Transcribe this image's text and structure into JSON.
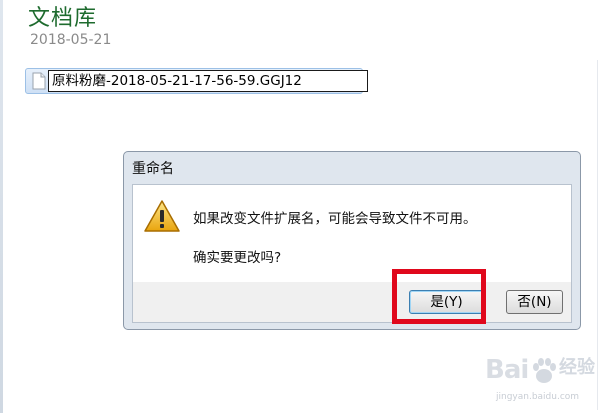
{
  "page": {
    "title": "文档库",
    "date": "2018-05-21"
  },
  "file": {
    "name_value": "原料粉磨-2018-05-21-17-56-59.GGJ12"
  },
  "dialog": {
    "title": "重命名",
    "message_line1": "如果改变文件扩展名，可能会导致文件不可用。",
    "message_line2": "确实要更改吗?",
    "yes_label": "是(Y)",
    "no_label": "否(N)"
  },
  "watermark": {
    "logo_text": "Bai",
    "suffix": "经验",
    "url": "jingyan.baidu.com"
  },
  "colors": {
    "title_green": "#1e6b2e",
    "highlight_red": "#e0081c"
  },
  "icons": [
    "file-icon",
    "warning-icon",
    "baidu-paw-icon"
  ]
}
